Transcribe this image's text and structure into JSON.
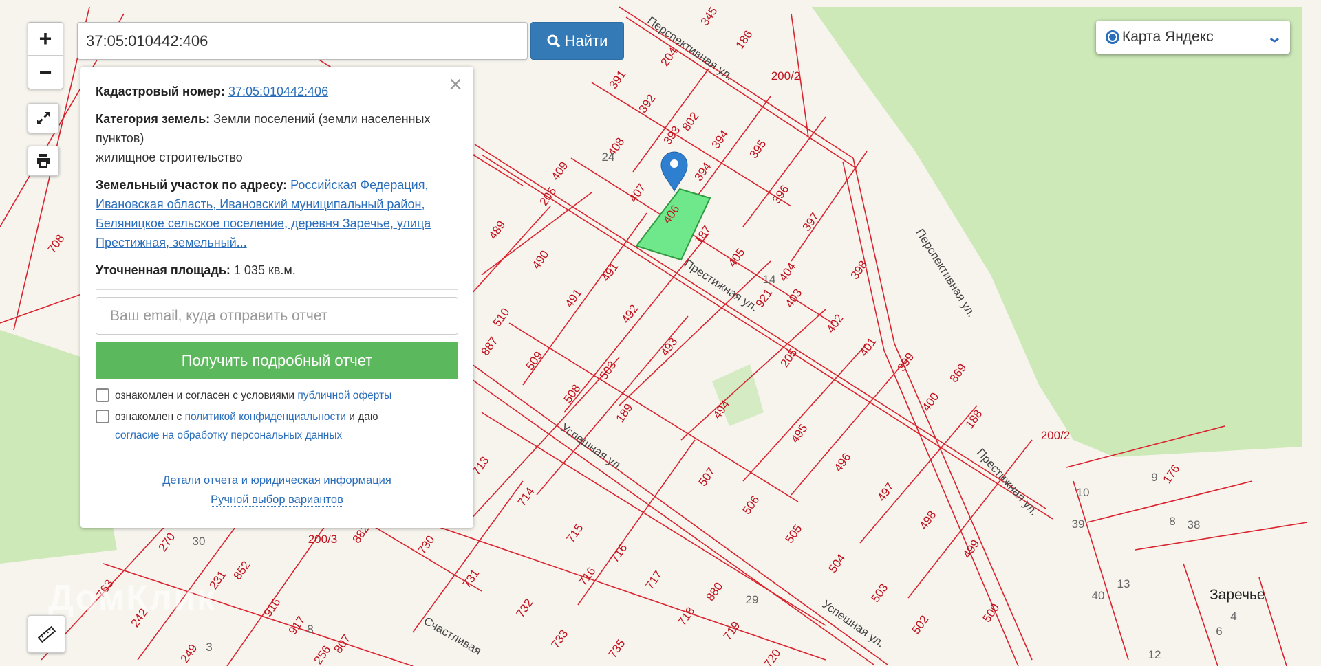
{
  "search": {
    "value": "37:05:010442:406",
    "button": "Найти"
  },
  "controls": {
    "zoom_in": "+",
    "zoom_out": "−"
  },
  "layer": {
    "selected": "Карта Яндекс"
  },
  "popup": {
    "cadastral_label": "Кадастровый номер:",
    "cadastral_value": "37:05:010442:406",
    "category_label": "Категория земель:",
    "category_value": "Земли поселений (земли населенных пунктов)",
    "category_use": "жилищное строительство",
    "address_label": "Земельный участок по адресу:",
    "address_value": "Российская Федерация, Ивановская область, Ивановский муниципальный район, Беляницкое сельское поселение, деревня Заречье, улица Престижная, земельный...",
    "area_label": "Уточненная площадь:",
    "area_value": "1 035 кв.м.",
    "email_placeholder": "Ваш email, куда отправить отчет",
    "get_report": "Получить подробный отчет",
    "consent1_text": "ознакомлен и согласен с условиями",
    "consent1_link": "публичной оферты",
    "consent2_text": "ознакомлен с",
    "consent2_link": "политикой конфиденциальности",
    "consent2_mid": "и даю",
    "consent2_link2": "согласие на обработку персональных данных",
    "details_link": "Детали отчета и юридическая информация",
    "manual_link": "Ручной выбор вариантов"
  },
  "watermark": "ДомКлик",
  "map": {
    "parcels": [
      "345",
      "186",
      "204",
      "200/2",
      "391",
      "392",
      "802",
      "393",
      "394",
      "395",
      "408",
      "409",
      "407",
      "394",
      "406",
      "187",
      "396",
      "397",
      "205",
      "489",
      "490",
      "491",
      "491",
      "405",
      "404",
      "398",
      "921",
      "403",
      "402",
      "492",
      "510",
      "493",
      "401",
      "399",
      "887",
      "509",
      "205",
      "869",
      "508",
      "503",
      "189",
      "494",
      "400",
      "188",
      "495",
      "200/2",
      "713",
      "496",
      "507",
      "714",
      "497",
      "176",
      "9",
      "10",
      "506",
      "498",
      "39",
      "38",
      "8",
      "715",
      "716",
      "505",
      "499",
      "730",
      "270",
      "30",
      "882",
      "200/3",
      "504",
      "731",
      "716",
      "717",
      "231",
      "852",
      "763",
      "880",
      "503",
      "40",
      "13",
      "732",
      "29",
      "718",
      "500",
      "242",
      "916",
      "917",
      "8",
      "502",
      "4",
      "719",
      "733",
      "735",
      "807",
      "256",
      "249",
      "3",
      "720",
      "6",
      "12",
      "708",
      "24",
      "14"
    ],
    "streets": [
      "Перспективная ул.",
      "Перспективная ул.",
      "Престижная ул.",
      "Престижная ул.",
      "Успешная ул.",
      "Успешная ул.",
      "Счастливая"
    ],
    "village": "Заречье"
  }
}
